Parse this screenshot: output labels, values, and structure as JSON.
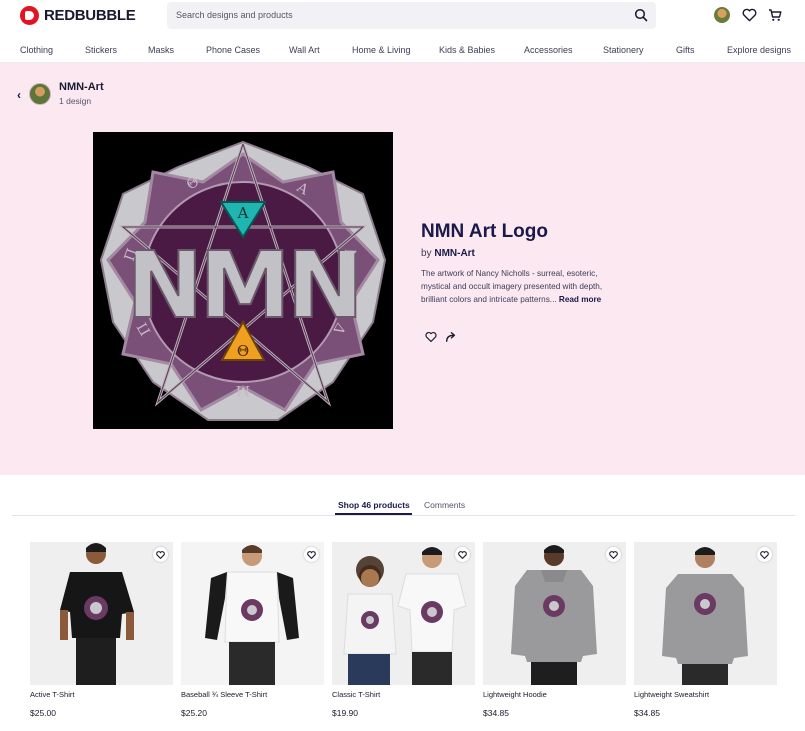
{
  "brand": {
    "name": "REDBUBBLE",
    "color": "#e41321"
  },
  "search": {
    "placeholder": "Search designs and products"
  },
  "nav": [
    "Clothing",
    "Stickers",
    "Masks",
    "Phone Cases",
    "Wall Art",
    "Home & Living",
    "Kids & Babies",
    "Accessories",
    "Stationery",
    "Gifts",
    "Explore designs"
  ],
  "artist": {
    "name": "NMN-Art",
    "count": "1 design"
  },
  "work": {
    "artwork_letters": "NMN",
    "artwork_glyphs": [
      "A",
      "Θ",
      "Θ",
      "A",
      "A",
      "Π",
      "Π",
      "Δ",
      "Δ",
      "M"
    ],
    "title": "NMN Art Logo",
    "by_prefix": "by",
    "by_name": "NMN-Art",
    "description": "The artwork of Nancy Nicholls - surreal, esoteric, mystical and occult imagery presented with depth, brilliant colors and intricate patterns...",
    "read_more": "Read more"
  },
  "tabs": {
    "shop": "Shop 46 products",
    "comments": "Comments"
  },
  "products": [
    {
      "name": "Active T-Shirt",
      "price": "$25.00"
    },
    {
      "name": "Baseball ¾ Sleeve T-Shirt",
      "price": "$25.20"
    },
    {
      "name": "Classic T-Shirt",
      "price": "$19.90"
    },
    {
      "name": "Lightweight Hoodie",
      "price": "$34.85"
    },
    {
      "name": "Lightweight Sweatshirt",
      "price": "$34.85"
    }
  ],
  "colors": {
    "hero_bg": "#fbe8f1",
    "accent": "#1a1a4a",
    "logo_purple": "#5a2a55",
    "logo_teal": "#1fb5b0",
    "logo_orange": "#f0a020"
  },
  "icons": [
    "search-icon",
    "heart-icon",
    "cart-icon",
    "chevron-left-icon",
    "share-icon"
  ]
}
